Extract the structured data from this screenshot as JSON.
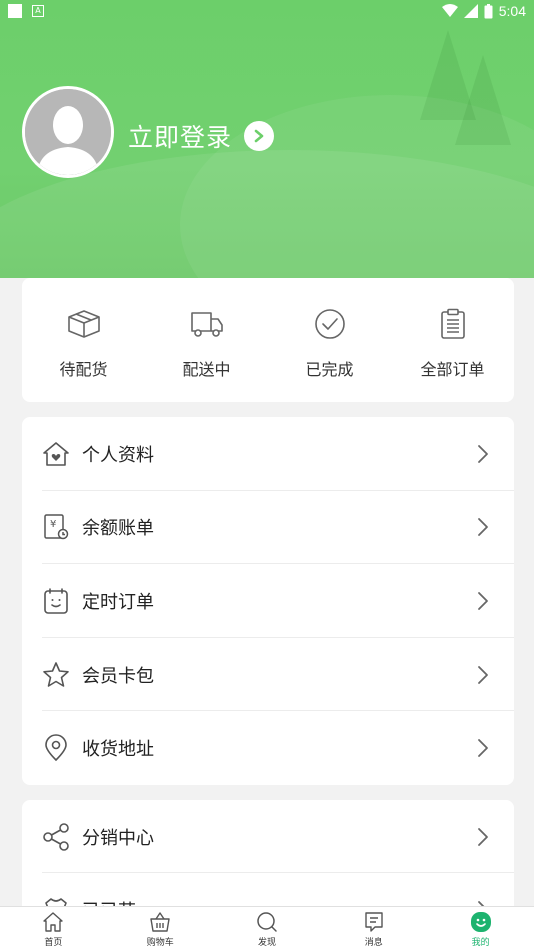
{
  "status_bar": {
    "time": "5:04"
  },
  "profile": {
    "login_text": "立即登录"
  },
  "orders": [
    {
      "label": "待配货",
      "icon": "box-icon"
    },
    {
      "label": "配送中",
      "icon": "truck-icon"
    },
    {
      "label": "已完成",
      "icon": "check-circle-icon"
    },
    {
      "label": "全部订单",
      "icon": "clipboard-icon"
    }
  ],
  "menu_primary": [
    {
      "label": "个人资料",
      "icon": "home-heart-icon"
    },
    {
      "label": "余额账单",
      "icon": "bill-icon"
    },
    {
      "label": "定时订单",
      "icon": "alarm-icon"
    },
    {
      "label": "会员卡包",
      "icon": "star-icon"
    },
    {
      "label": "收货地址",
      "icon": "location-pin-icon"
    }
  ],
  "menu_secondary": [
    {
      "label": "分销中心",
      "icon": "share-icon"
    },
    {
      "label": "已已芭",
      "icon": "shirt-icon"
    }
  ],
  "tabbar": [
    {
      "label": "首页",
      "icon": "home-icon",
      "active": false
    },
    {
      "label": "购物车",
      "icon": "basket-icon",
      "active": false
    },
    {
      "label": "发现",
      "icon": "discover-icon",
      "active": false
    },
    {
      "label": "消息",
      "icon": "message-icon",
      "active": false
    },
    {
      "label": "我的",
      "icon": "smile-icon",
      "active": true
    }
  ],
  "colors": {
    "header_green": "#6ccf6a",
    "active_tab": "#1db36f"
  }
}
